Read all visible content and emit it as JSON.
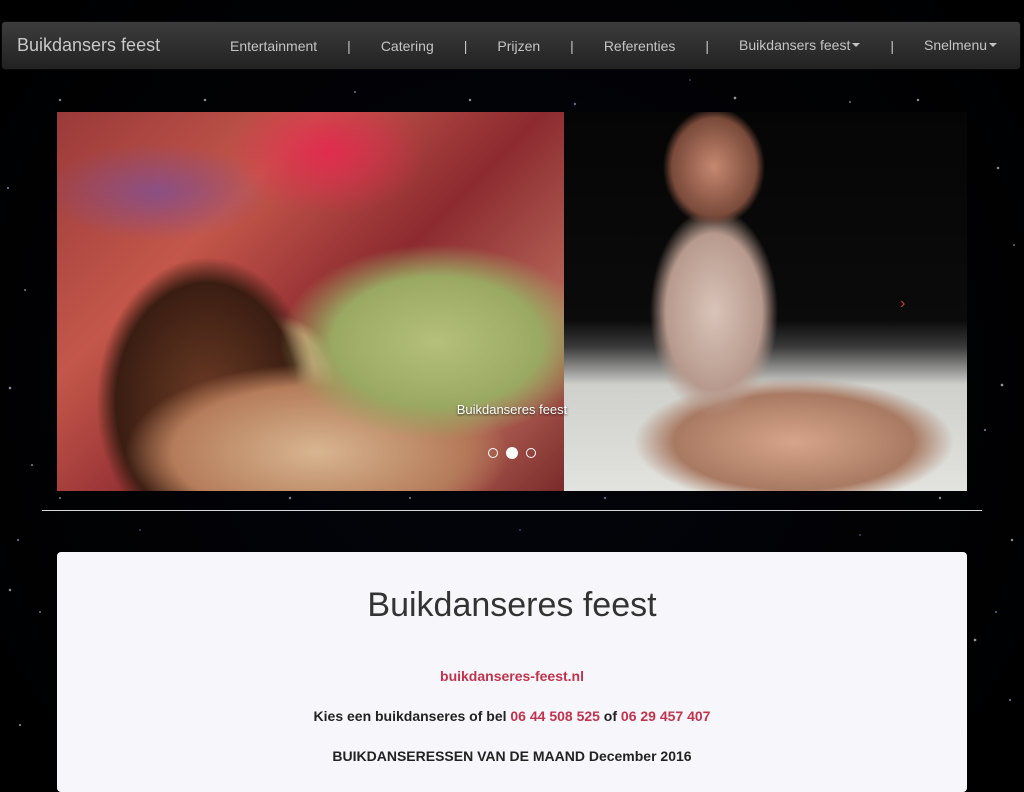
{
  "navbar": {
    "brand": "Buikdansers feest",
    "items": [
      {
        "label": "Entertainment"
      },
      {
        "label": "Catering"
      },
      {
        "label": "Prijzen"
      },
      {
        "label": "Referenties"
      },
      {
        "label": "Buikdansers feest"
      },
      {
        "label": "Snelmenu"
      }
    ],
    "separator": "|"
  },
  "carousel": {
    "caption": "Buikdanseres feest",
    "indicator_count": 3,
    "active_index": 1,
    "next_icon": "chevron-right-icon",
    "next_glyph": "›"
  },
  "card": {
    "title": "Buikdanseres feest",
    "site_link": "buikdanseres-feest.nl",
    "call_prefix": "Kies een buikdanseres of bel ",
    "phone1": "06 44 508 525",
    "call_of": " of ",
    "phone2": "06 29 457 407",
    "month_line": "BUIKDANSERESSEN VAN DE MAAND December 2016"
  },
  "colors": {
    "link": "#c0334d",
    "navbar_bg": "#2b2b2b",
    "card_bg": "#f7f7fb"
  }
}
